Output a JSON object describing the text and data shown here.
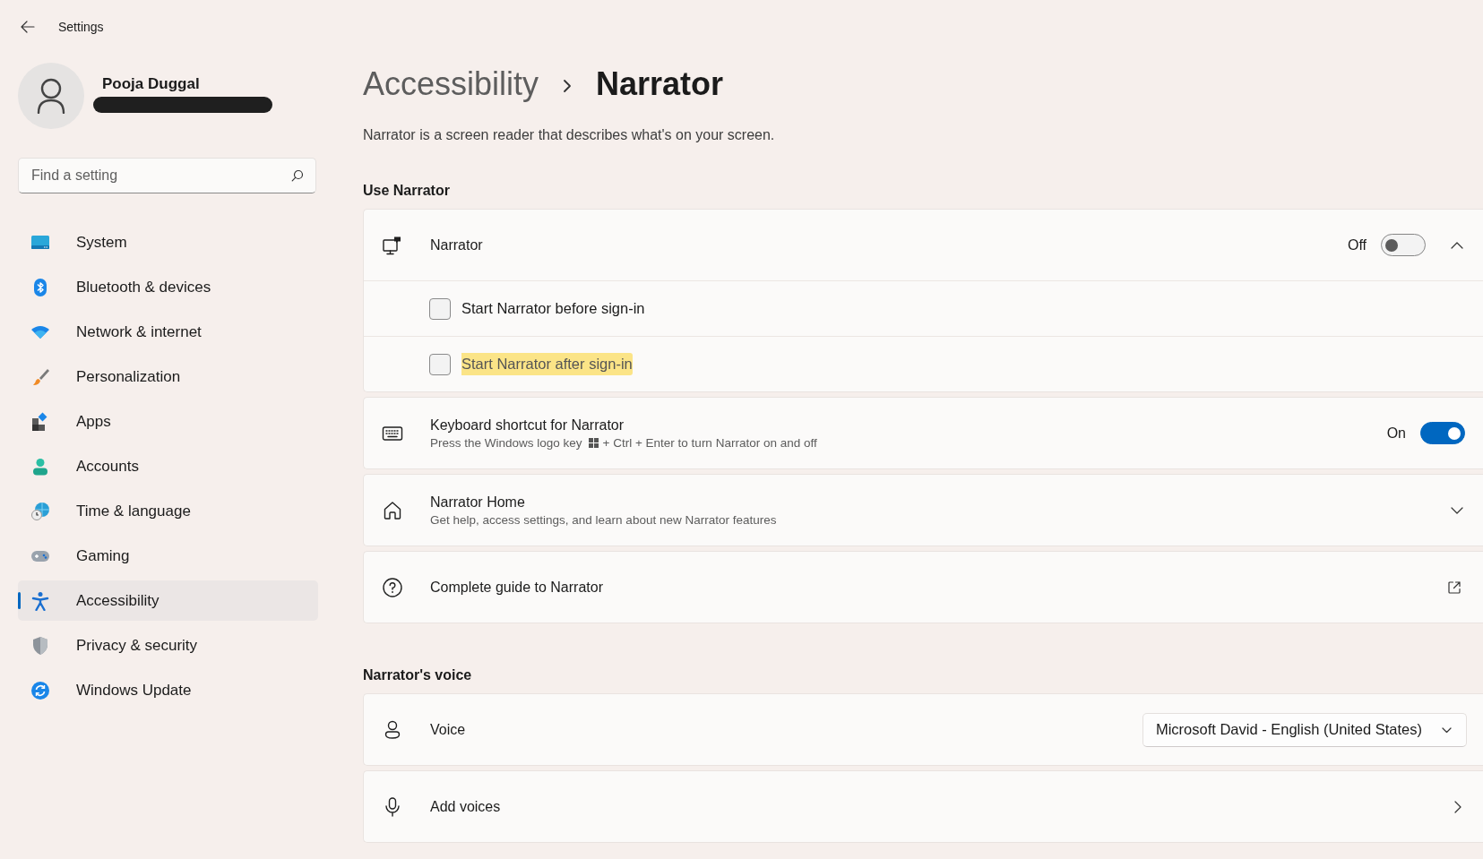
{
  "window": {
    "title": "Settings"
  },
  "profile": {
    "name": "Pooja Duggal"
  },
  "search": {
    "placeholder": "Find a setting"
  },
  "sidebar": {
    "items": [
      {
        "label": "System",
        "kind": "system",
        "selected": false
      },
      {
        "label": "Bluetooth & devices",
        "kind": "bluetooth",
        "selected": false
      },
      {
        "label": "Network & internet",
        "kind": "network",
        "selected": false
      },
      {
        "label": "Personalization",
        "kind": "personalization",
        "selected": false
      },
      {
        "label": "Apps",
        "kind": "apps",
        "selected": false
      },
      {
        "label": "Accounts",
        "kind": "accounts",
        "selected": false
      },
      {
        "label": "Time & language",
        "kind": "time",
        "selected": false
      },
      {
        "label": "Gaming",
        "kind": "gaming",
        "selected": false
      },
      {
        "label": "Accessibility",
        "kind": "accessibility",
        "selected": true
      },
      {
        "label": "Privacy & security",
        "kind": "privacy",
        "selected": false
      },
      {
        "label": "Windows Update",
        "kind": "update",
        "selected": false
      }
    ]
  },
  "page": {
    "breadcrumb_parent": "Accessibility",
    "title": "Narrator",
    "description": "Narrator is a screen reader that describes what's on your screen."
  },
  "sections": [
    {
      "heading": "Use Narrator",
      "cards": [
        {
          "kind": "toggle",
          "title": "Narrator",
          "toggle": {
            "label": "Off",
            "on": false
          },
          "expanded": true,
          "options": [
            {
              "label": "Start Narrator before sign-in",
              "checked": false,
              "highlighted": false
            },
            {
              "label": "Start Narrator after sign-in",
              "checked": false,
              "highlighted": true
            }
          ]
        },
        {
          "kind": "toggle",
          "title": "Keyboard shortcut for Narrator",
          "subtitle": [
            "Press the Windows logo key",
            "+ Ctrl + Enter to turn Narrator on and off"
          ],
          "toggle": {
            "label": "On",
            "on": true
          }
        },
        {
          "kind": "expander",
          "title": "Narrator Home",
          "subtitle": [
            "Get help, access settings, and learn about new Narrator features"
          ],
          "expanded": false
        },
        {
          "kind": "link",
          "title": "Complete guide to Narrator"
        }
      ]
    },
    {
      "heading": "Narrator's voice",
      "cards": [
        {
          "kind": "dropdown",
          "title": "Voice",
          "value": "Microsoft David - English (United States)"
        },
        {
          "kind": "nav",
          "title": "Add voices"
        }
      ]
    }
  ]
}
